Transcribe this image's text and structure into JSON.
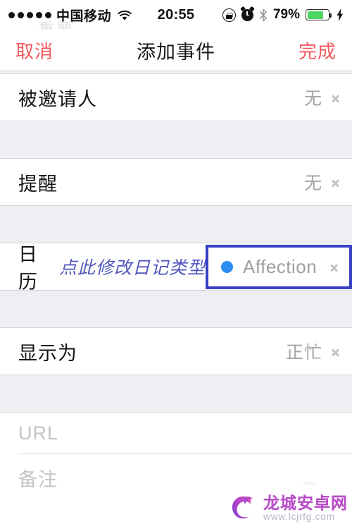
{
  "status_bar": {
    "signal_dots": 5,
    "carrier": "中国移动",
    "wifi_icon": "wifi-icon",
    "time": "20:55",
    "rotation_lock_icon": "rotation-lock-icon",
    "alarm_icon": "alarm-clock-icon",
    "bluetooth_icon": "bluetooth-icon",
    "battery_percent": "79%",
    "battery_level": 79,
    "battery_color": "#4cd562",
    "charging_icon": "lightning-bolt-icon",
    "ghost_text": "重要"
  },
  "nav_bar": {
    "cancel_label": "取消",
    "title": "添加事件",
    "done_label": "完成",
    "action_color": "#f2585b"
  },
  "rows": [
    {
      "label": "被邀请人",
      "value": "无",
      "chevron": "chevron-right-icon"
    },
    {
      "label": "提醒",
      "value": "无",
      "chevron": "chevron-right-icon"
    }
  ],
  "calendar_row": {
    "label": "日历",
    "annotation": "点此修改日记类型",
    "annotation_color": "#5156bf",
    "calendar_name": "Affection",
    "calendar_dot_color": "#2b8ef0",
    "highlight_border_color": "#3a3fc4",
    "chevron": "chevron-right-icon"
  },
  "show_as_row": {
    "label": "显示为",
    "value": "正忙",
    "chevron": "chevron-right-icon"
  },
  "fields": {
    "url_placeholder": "URL",
    "notes_placeholder": "备注"
  },
  "watermark": {
    "site_name": "龙城安卓网",
    "site_url": "www.lcjrfg.com",
    "logo_icon": "dragon-c-logo-icon"
  }
}
